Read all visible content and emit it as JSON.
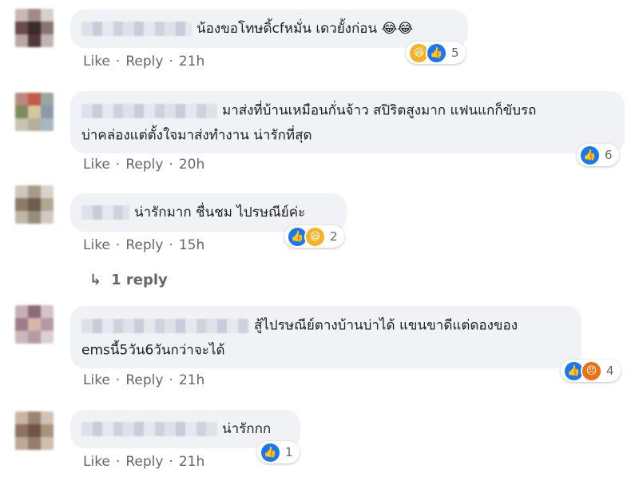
{
  "colors": {
    "bubble_bg": "#f0f2f5",
    "meta_text": "#65676b",
    "like_blue": "#1877f2",
    "haha_yellow": "#f7b125",
    "angry_orange": "#e9710f"
  },
  "labels": {
    "like": "Like",
    "reply": "Reply",
    "separator": "·"
  },
  "comments": [
    {
      "text": "น้องขอโทษดิ้cfหมั่น เดวยั้งก่อน 😂😂",
      "time": "21h",
      "reactions": [
        "haha",
        "like"
      ],
      "reaction_count": "5"
    },
    {
      "text_line1": "มาส่งที่บ้านเหมือนกั่นจ้าว สปิริตสูงมาก แฟนแกก็ขับรถ",
      "text_line2": "บ่าคล่องแต่ตั้งใจมาส่งทำงาน น่ารักที่สุด",
      "time": "20h",
      "reactions": [
        "like"
      ],
      "reaction_count": "6"
    },
    {
      "text": "น่ารักมาก ชื่นชม ไปรษณีย์ค่ะ",
      "time": "15h",
      "reactions": [
        "like",
        "haha"
      ],
      "reaction_count": "2",
      "replies_label": "1 reply"
    },
    {
      "text_line1": "สู้ไปรษณีย์ตางบ้านบ่าได้ แขนขาดีแต่ดองของ",
      "text_line2": "emsนี้5วัน6วันกว่าจะได้",
      "time": "21h",
      "reactions": [
        "like",
        "angry"
      ],
      "reaction_count": "4"
    },
    {
      "text": "น่ารักกก",
      "time": "21h",
      "reactions": [
        "like"
      ],
      "reaction_count": "1"
    }
  ]
}
